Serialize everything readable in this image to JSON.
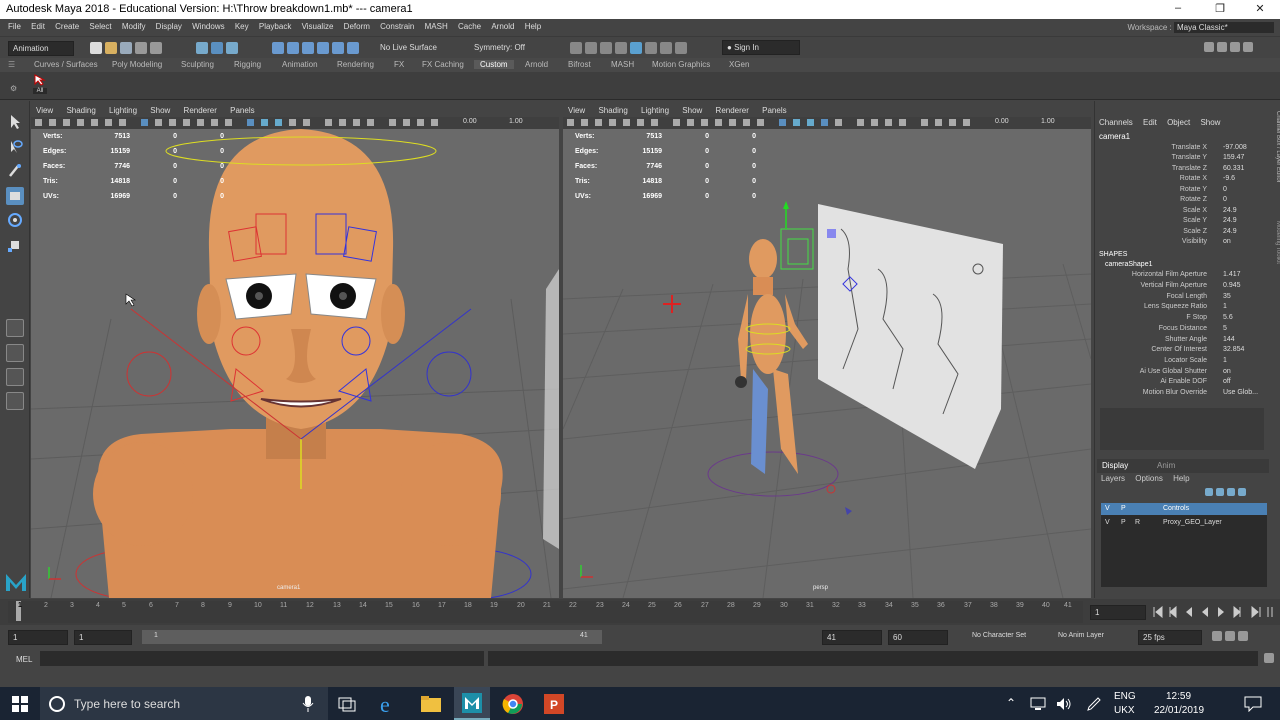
{
  "window": {
    "title": "Autodesk Maya 2018 - Educational Version: H:\\Throw breakdown1.mb*  ---  camera1",
    "minimize": "–",
    "maximize": "❐",
    "close": "✕"
  },
  "menu": [
    "File",
    "Edit",
    "Create",
    "Select",
    "Modify",
    "Display",
    "Windows",
    "Key",
    "Playback",
    "Visualize",
    "Deform",
    "Constrain",
    "MASH",
    "Cache",
    "Arnold",
    "Help"
  ],
  "workspace": {
    "label": "Workspace :",
    "value": "Maya Classic*"
  },
  "statusline": {
    "mode": "Animation",
    "live_surface": "No Live Surface",
    "symmetry": "Symmetry: Off",
    "sign_in": "Sign In"
  },
  "shelf": {
    "tabs": [
      "Curves / Surfaces",
      "Poly Modeling",
      "Sculpting",
      "Rigging",
      "Animation",
      "Rendering",
      "FX",
      "FX Caching",
      "Custom",
      "Arnold",
      "Bifrost",
      "MASH",
      "Motion Graphics",
      "XGen"
    ],
    "active_tab": "Custom",
    "button_label": "All"
  },
  "viewport_menu": [
    "View",
    "Shading",
    "Lighting",
    "Show",
    "Renderer",
    "Panels"
  ],
  "viewport_fields": {
    "exposure": "0.00",
    "gamma": "1.00"
  },
  "hud": {
    "rows": [
      {
        "label": "Verts:",
        "a": "7513",
        "b": "0",
        "c": "0"
      },
      {
        "label": "Edges:",
        "a": "15159",
        "b": "0",
        "c": "0"
      },
      {
        "label": "Faces:",
        "a": "7746",
        "b": "0",
        "c": "0"
      },
      {
        "label": "Tris:",
        "a": "14818",
        "b": "0",
        "c": "0"
      },
      {
        "label": "UVs:",
        "a": "16969",
        "b": "0",
        "c": "0"
      }
    ]
  },
  "viewports": {
    "left_camera": "camera1",
    "right_camera": "persp"
  },
  "channel_box": {
    "menu": [
      "Channels",
      "Edit",
      "Object",
      "Show"
    ],
    "object": "camera1",
    "attributes": [
      {
        "label": "Translate X",
        "value": "-97.008"
      },
      {
        "label": "Translate Y",
        "value": "159.47"
      },
      {
        "label": "Translate Z",
        "value": "60.331"
      },
      {
        "label": "Rotate X",
        "value": "-9.6"
      },
      {
        "label": "Rotate Y",
        "value": "0"
      },
      {
        "label": "Rotate Z",
        "value": "0"
      },
      {
        "label": "Scale X",
        "value": "24.9"
      },
      {
        "label": "Scale Y",
        "value": "24.9"
      },
      {
        "label": "Scale Z",
        "value": "24.9"
      },
      {
        "label": "Visibility",
        "value": "on"
      }
    ],
    "shapes_header": "SHAPES",
    "shape_name": "cameraShape1",
    "shape_attributes": [
      {
        "label": "Horizontal Film Aperture",
        "value": "1.417"
      },
      {
        "label": "Vertical Film Aperture",
        "value": "0.945"
      },
      {
        "label": "Focal Length",
        "value": "35"
      },
      {
        "label": "Lens Squeeze Ratio",
        "value": "1"
      },
      {
        "label": "F Stop",
        "value": "5.6"
      },
      {
        "label": "Focus Distance",
        "value": "5"
      },
      {
        "label": "Shutter Angle",
        "value": "144"
      },
      {
        "label": "Center Of Interest",
        "value": "32.854"
      },
      {
        "label": "Locator Scale",
        "value": "1"
      },
      {
        "label": "Ai Use Global Shutter",
        "value": "on"
      },
      {
        "label": "Ai Enable DOF",
        "value": "off"
      },
      {
        "label": "Motion Blur Override",
        "value": "Use Glob..."
      }
    ],
    "side_tabs": [
      "Channel Box / Layer Editor",
      "Modeling Toolkit"
    ]
  },
  "layer_editor": {
    "tabs": [
      "Display",
      "Anim"
    ],
    "menu": [
      "Layers",
      "Options",
      "Help"
    ],
    "layers": [
      {
        "v": "V",
        "p": "P",
        "r": "",
        "name": "Controls",
        "selected": true
      },
      {
        "v": "V",
        "p": "P",
        "r": "R",
        "name": "Proxy_GEO_Layer",
        "selected": false
      }
    ]
  },
  "timeline": {
    "ticks": [
      "1",
      "2",
      "3",
      "4",
      "5",
      "6",
      "7",
      "8",
      "9",
      "10",
      "11",
      "12",
      "13",
      "14",
      "15",
      "16",
      "17",
      "18",
      "19",
      "20",
      "21",
      "22",
      "23",
      "24",
      "25",
      "26",
      "27",
      "28",
      "29",
      "30",
      "31",
      "32",
      "33",
      "34",
      "35",
      "36",
      "37",
      "38",
      "39",
      "40",
      "41"
    ],
    "current_frame": "1"
  },
  "range": {
    "start": "1",
    "inner_start": "1",
    "slider_start": "1",
    "slider_end": "41",
    "inner_end": "41",
    "end": "60",
    "character_set": "No Character Set",
    "anim_layer": "No Anim Layer",
    "fps": "25 fps"
  },
  "cmdline": {
    "label": "MEL"
  },
  "taskbar": {
    "search_placeholder": "Type here to search",
    "lang": "ENG",
    "region": "UKX",
    "time": "12:59",
    "date": "22/01/2019"
  },
  "colors": {
    "ui_bg": "#444444",
    "viewport_bg": "#6a6a6a",
    "accent_blue": "#4a90c8",
    "selected_layer": "#4a80b4",
    "skin": "#d9905a"
  }
}
